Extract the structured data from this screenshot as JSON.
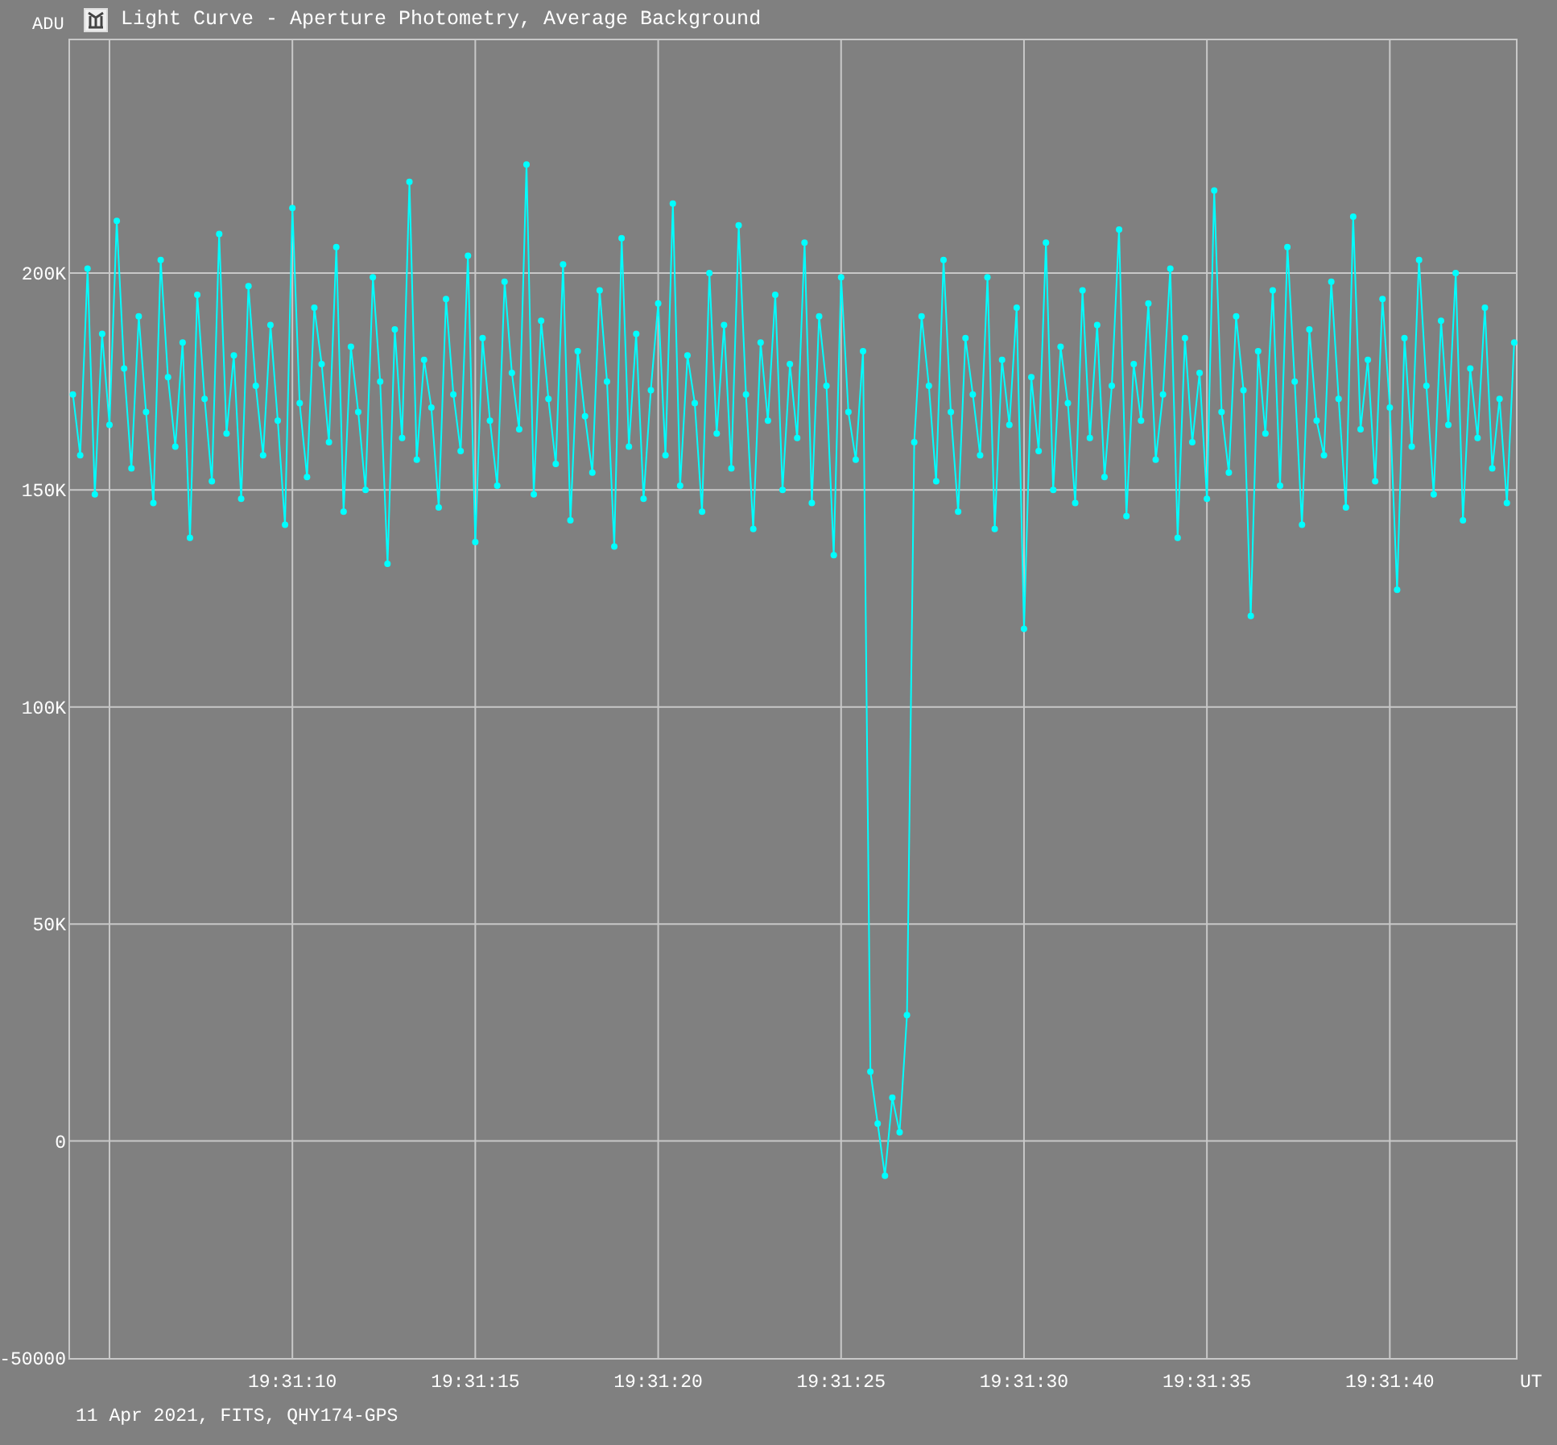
{
  "window": {
    "title": "Light Curve - Aperture Photometry, Average Background"
  },
  "chart_data": {
    "type": "line",
    "grid": true,
    "xlabel": "UT",
    "ylabel": "ADU",
    "xlim": [
      70263.9,
      70303.47
    ],
    "ylim": [
      -50000,
      254000
    ],
    "xticks": [
      {
        "value": 70270,
        "label": "19:31:10"
      },
      {
        "value": 70275,
        "label": "19:31:15"
      },
      {
        "value": 70280,
        "label": "19:31:20"
      },
      {
        "value": 70285,
        "label": "19:31:25"
      },
      {
        "value": 70290,
        "label": "19:31:30"
      },
      {
        "value": 70295,
        "label": "19:31:35"
      },
      {
        "value": 70300,
        "label": "19:31:40"
      }
    ],
    "yticks": [
      {
        "value": 200000,
        "label": "200K"
      },
      {
        "value": 150000,
        "label": "150K"
      },
      {
        "value": 100000,
        "label": "100K"
      },
      {
        "value": 50000,
        "label": "50K"
      },
      {
        "value": 0,
        "label": "0"
      },
      {
        "value": -50000,
        "label": "-50000"
      }
    ],
    "x": [
      70264,
      70264.2,
      70264.4,
      70264.6,
      70264.8,
      70265,
      70265.2,
      70265.4,
      70265.6,
      70265.8,
      70266,
      70266.2,
      70266.4,
      70266.6,
      70266.8,
      70267,
      70267.2,
      70267.4,
      70267.6,
      70267.8,
      70268,
      70268.2,
      70268.4,
      70268.6,
      70268.8,
      70269,
      70269.2,
      70269.4,
      70269.6,
      70269.8,
      70270,
      70270.2,
      70270.4,
      70270.6,
      70270.8,
      70271,
      70271.2,
      70271.4,
      70271.6,
      70271.8,
      70272,
      70272.2,
      70272.4,
      70272.6,
      70272.8,
      70273,
      70273.2,
      70273.4,
      70273.6,
      70273.8,
      70274,
      70274.2,
      70274.4,
      70274.6,
      70274.8,
      70275,
      70275.2,
      70275.4,
      70275.6,
      70275.8,
      70276,
      70276.2,
      70276.4,
      70276.6,
      70276.8,
      70277,
      70277.2,
      70277.4,
      70277.6,
      70277.8,
      70278,
      70278.2,
      70278.4,
      70278.6,
      70278.8,
      70279,
      70279.2,
      70279.4,
      70279.6,
      70279.8,
      70280,
      70280.2,
      70280.4,
      70280.6,
      70280.8,
      70281,
      70281.2,
      70281.4,
      70281.6,
      70281.8,
      70282,
      70282.2,
      70282.4,
      70282.6,
      70282.8,
      70283,
      70283.2,
      70283.4,
      70283.6,
      70283.8,
      70284,
      70284.2,
      70284.4,
      70284.6,
      70284.8,
      70285,
      70285.2,
      70285.4,
      70285.6,
      70285.8,
      70286,
      70286.2,
      70286.4,
      70286.6,
      70286.8,
      70287,
      70287.2,
      70287.4,
      70287.6,
      70287.8,
      70288,
      70288.2,
      70288.4,
      70288.6,
      70288.8,
      70289,
      70289.2,
      70289.4,
      70289.6,
      70289.8,
      70290,
      70290.2,
      70290.4,
      70290.6,
      70290.8,
      70291,
      70291.2,
      70291.4,
      70291.6,
      70291.8,
      70292,
      70292.2,
      70292.4,
      70292.6,
      70292.8,
      70293,
      70293.2,
      70293.4,
      70293.6,
      70293.8,
      70294,
      70294.2,
      70294.4,
      70294.6,
      70294.8,
      70295,
      70295.2,
      70295.4,
      70295.6,
      70295.8,
      70296,
      70296.2,
      70296.4,
      70296.6,
      70296.8,
      70297,
      70297.2,
      70297.4,
      70297.6,
      70297.8,
      70298,
      70298.2,
      70298.4,
      70298.6,
      70298.8,
      70299,
      70299.2,
      70299.4,
      70299.6,
      70299.8,
      70300,
      70300.2,
      70300.4,
      70300.6,
      70300.8,
      70301,
      70301.2,
      70301.4,
      70301.6,
      70301.8,
      70302,
      70302.2,
      70302.4,
      70302.6,
      70302.8,
      70303,
      70303.2,
      70303.4
    ],
    "series": [
      {
        "color": "#00ffff",
        "marker": "circle",
        "values": [
          172000,
          158000,
          201000,
          149000,
          186000,
          165000,
          212000,
          178000,
          155000,
          190000,
          168000,
          147000,
          203000,
          176000,
          160000,
          184000,
          139000,
          195000,
          171000,
          152000,
          209000,
          163000,
          181000,
          148000,
          197000,
          174000,
          158000,
          188000,
          166000,
          142000,
          215000,
          170000,
          153000,
          192000,
          179000,
          161000,
          206000,
          145000,
          183000,
          168000,
          150000,
          199000,
          175000,
          133000,
          187000,
          162000,
          221000,
          157000,
          180000,
          169000,
          146000,
          194000,
          172000,
          159000,
          204000,
          138000,
          185000,
          166000,
          151000,
          198000,
          177000,
          164000,
          225000,
          149000,
          189000,
          171000,
          156000,
          202000,
          143000,
          182000,
          167000,
          154000,
          196000,
          175000,
          137000,
          208000,
          160000,
          186000,
          148000,
          173000,
          193000,
          158000,
          216000,
          151000,
          181000,
          170000,
          145000,
          200000,
          163000,
          188000,
          155000,
          211000,
          172000,
          141000,
          184000,
          166000,
          195000,
          150000,
          179000,
          162000,
          207000,
          147000,
          190000,
          174000,
          135000,
          199000,
          168000,
          157000,
          182000,
          16000,
          4000,
          -8000,
          10000,
          2000,
          29000,
          161000,
          190000,
          174000,
          152000,
          203000,
          168000,
          145000,
          185000,
          172000,
          158000,
          199000,
          141000,
          180000,
          165000,
          192000,
          118000,
          176000,
          159000,
          207000,
          150000,
          183000,
          170000,
          147000,
          196000,
          162000,
          188000,
          153000,
          174000,
          210000,
          144000,
          179000,
          166000,
          193000,
          157000,
          172000,
          201000,
          139000,
          185000,
          161000,
          177000,
          148000,
          219000,
          168000,
          154000,
          190000,
          173000,
          121000,
          182000,
          163000,
          196000,
          151000,
          206000,
          175000,
          142000,
          187000,
          166000,
          158000,
          198000,
          171000,
          146000,
          213000,
          164000,
          180000,
          152000,
          194000,
          169000,
          127000,
          185000,
          160000,
          203000,
          174000,
          149000,
          189000,
          165000,
          200000,
          143000,
          178000,
          162000,
          192000,
          155000,
          171000,
          147000,
          184000
        ]
      }
    ]
  },
  "footer": "11 Apr 2021, FITS, QHY174-GPS"
}
